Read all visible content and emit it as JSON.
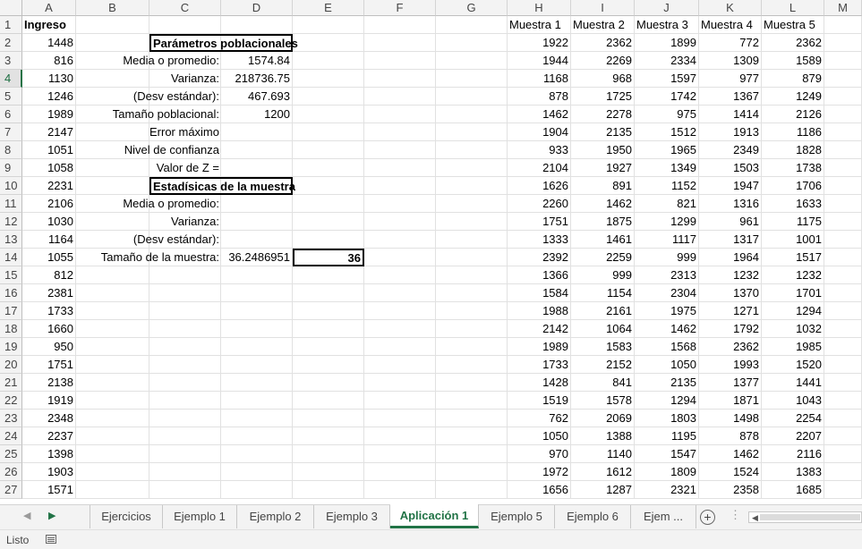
{
  "column_headers": [
    "A",
    "B",
    "C",
    "D",
    "E",
    "F",
    "G",
    "H",
    "I",
    "J",
    "K",
    "L",
    "M"
  ],
  "row_numbers": [
    "1",
    "2",
    "3",
    "4",
    "5",
    "6",
    "7",
    "8",
    "9",
    "10",
    "11",
    "12",
    "13",
    "14",
    "15",
    "16",
    "17",
    "18",
    "19",
    "20",
    "21",
    "22",
    "23",
    "24",
    "25",
    "26",
    "27"
  ],
  "selected_row": "4",
  "ingreso_header": "Ingreso",
  "ingreso": [
    "1448",
    "816",
    "1130",
    "1246",
    "1989",
    "2147",
    "1051",
    "1058",
    "2231",
    "2106",
    "1030",
    "1164",
    "1055",
    "812",
    "2381",
    "1733",
    "1660",
    "950",
    "1751",
    "2138",
    "1919",
    "2348",
    "2237",
    "1398",
    "1903",
    "1571"
  ],
  "parametros": {
    "title": "Parámetros poblacionales",
    "media_label": "Media o promedio:",
    "media_value": "1574.84",
    "varianza_label": "Varianza:",
    "varianza_value": "218736.75",
    "desv_label": "(Desv estándar):",
    "desv_value": "467.693",
    "tam_label": "Tamaño poblacional:",
    "tam_value": "1200",
    "error_label": "Error máximo",
    "nivel_label": "Nivel de confianza",
    "z_label": "Valor de Z ="
  },
  "muestra_stats": {
    "title": "Estadísicas de la muestra",
    "media_label": "Media o promedio:",
    "varianza_label": "Varianza:",
    "desv_label": "(Desv estándar):",
    "tam_label": "Tamaño de la muestra:",
    "tam_value": "36.2486951",
    "tam_rounded": "36"
  },
  "muestras_headers": [
    "Muestra 1",
    "Muestra 2",
    "Muestra 3",
    "Muestra 4",
    "Muestra 5"
  ],
  "muestras_rows": [
    [
      "1922",
      "2362",
      "1899",
      "772",
      "2362"
    ],
    [
      "1944",
      "2269",
      "2334",
      "1309",
      "1589"
    ],
    [
      "1168",
      "968",
      "1597",
      "977",
      "879"
    ],
    [
      "878",
      "1725",
      "1742",
      "1367",
      "1249"
    ],
    [
      "1462",
      "2278",
      "975",
      "1414",
      "2126"
    ],
    [
      "1904",
      "2135",
      "1512",
      "1913",
      "1186"
    ],
    [
      "933",
      "1950",
      "1965",
      "2349",
      "1828"
    ],
    [
      "2104",
      "1927",
      "1349",
      "1503",
      "1738"
    ],
    [
      "1626",
      "891",
      "1152",
      "1947",
      "1706"
    ],
    [
      "2260",
      "1462",
      "821",
      "1316",
      "1633"
    ],
    [
      "1751",
      "1875",
      "1299",
      "961",
      "1175"
    ],
    [
      "1333",
      "1461",
      "1117",
      "1317",
      "1001"
    ],
    [
      "2392",
      "2259",
      "999",
      "1964",
      "1517"
    ],
    [
      "1366",
      "999",
      "2313",
      "1232",
      "1232"
    ],
    [
      "1584",
      "1154",
      "2304",
      "1370",
      "1701"
    ],
    [
      "1988",
      "2161",
      "1975",
      "1271",
      "1294"
    ],
    [
      "2142",
      "1064",
      "1462",
      "1792",
      "1032"
    ],
    [
      "1989",
      "1583",
      "1568",
      "2362",
      "1985"
    ],
    [
      "1733",
      "2152",
      "1050",
      "1993",
      "1520"
    ],
    [
      "1428",
      "841",
      "2135",
      "1377",
      "1441"
    ],
    [
      "1519",
      "1578",
      "1294",
      "1871",
      "1043"
    ],
    [
      "762",
      "2069",
      "1803",
      "1498",
      "2254"
    ],
    [
      "1050",
      "1388",
      "1195",
      "878",
      "2207"
    ],
    [
      "970",
      "1140",
      "1547",
      "1462",
      "2116"
    ],
    [
      "1972",
      "1612",
      "1809",
      "1524",
      "1383"
    ],
    [
      "1656",
      "1287",
      "2321",
      "2358",
      "1685"
    ]
  ],
  "sheet_tabs": [
    "Ejercicios",
    "Ejemplo 1",
    "Ejemplo 2",
    "Ejemplo 3",
    "Aplicación 1",
    "Ejemplo 5",
    "Ejemplo 6",
    "Ejem ..."
  ],
  "active_tab": "Aplicación 1",
  "add_sheet_symbol": "+",
  "more_symbol": "⋮",
  "nav_prev_symbol": "◀",
  "nav_next_symbol": "▶",
  "status": "Listo",
  "colors": {
    "accent": "#217346",
    "grid": "#e1e1e1",
    "header_bg": "#f3f3f3"
  },
  "icons": [
    "sheet-nav-prev-icon",
    "sheet-nav-next-icon",
    "add-sheet-icon",
    "macro-record-icon"
  ]
}
